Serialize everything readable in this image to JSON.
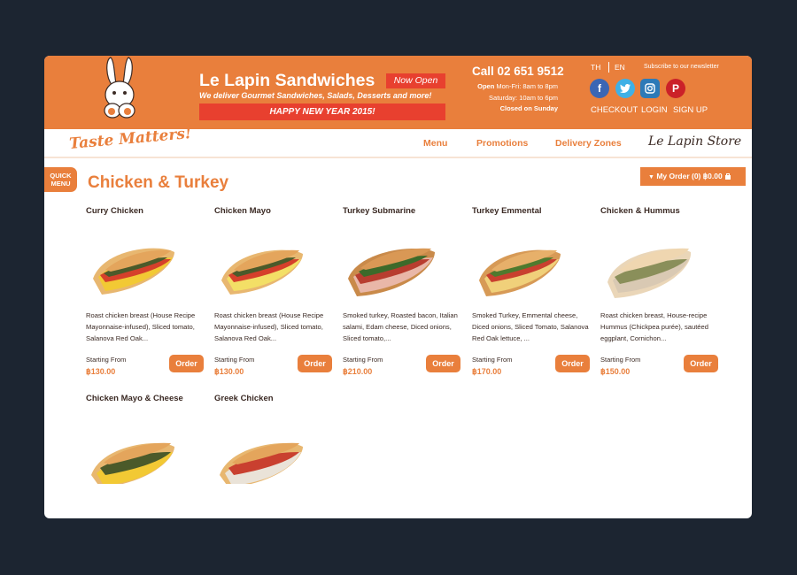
{
  "header": {
    "brand_title": "Le Lapin Sandwiches",
    "now_open": "Now Open",
    "tagline": "We deliver Gourmet Sandwiches, Salads, Desserts and more!",
    "promo_banner": "HAPPY NEW YEAR 2015!",
    "phone": "Call 02 651 9512",
    "hours_label": "Open",
    "hours_weekdays": "Mon-Fri: 8am to 8pm",
    "hours_saturday": "Saturday: 10am to 6pm",
    "hours_sunday": "Closed on Sunday",
    "lang_th": "TH",
    "lang_en": "EN",
    "newsletter": "Subscribe to our newsletter",
    "social_icons": [
      "facebook-icon",
      "twitter-icon",
      "instagram-icon",
      "pinterest-icon"
    ],
    "links": {
      "checkout": "CHECKOUT",
      "login": "LOGIN",
      "signup": "SIGN UP"
    }
  },
  "nav": {
    "slogan": "Taste Matters!",
    "items": [
      "Menu",
      "Promotions",
      "Delivery Zones"
    ],
    "store": "Le Lapin Store"
  },
  "content": {
    "quick_menu_line1": "QUICK",
    "quick_menu_line2": "MENU",
    "page_title": "Chicken & Turkey",
    "my_order": "My Order (0) ฿0.00"
  },
  "products": [
    {
      "name": "Curry Chicken",
      "desc": "Roast chicken breast (House Recipe Mayonnaise-infused), Sliced tomato, Salanova Red Oak...",
      "starting_label": "Starting From",
      "price": "฿130.00",
      "order_label": "Order"
    },
    {
      "name": "Chicken Mayo",
      "desc": "Roast chicken breast (House Recipe Mayonnaise-infused), Sliced tomato, Salanova Red Oak...",
      "starting_label": "Starting From",
      "price": "฿130.00",
      "order_label": "Order"
    },
    {
      "name": "Turkey Submarine",
      "desc": "Smoked turkey, Roasted bacon, Italian salami, Edam cheese, Diced onions, Sliced tomato,...",
      "starting_label": "Starting From",
      "price": "฿210.00",
      "order_label": "Order"
    },
    {
      "name": "Turkey Emmental",
      "desc": "Smoked Turkey, Emmental cheese, Diced onions, Sliced Tomato, Salanova Red Oak lettuce, ...",
      "starting_label": "Starting From",
      "price": "฿170.00",
      "order_label": "Order"
    },
    {
      "name": "Chicken & Hummus",
      "desc": "Roast chicken breast, House-recipe Hummus (Chickpea purée), sautéed eggplant, Cornichon...",
      "starting_label": "Starting From",
      "price": "฿150.00",
      "order_label": "Order"
    },
    {
      "name": "Chicken Mayo & Cheese"
    },
    {
      "name": "Greek Chicken"
    }
  ],
  "colors": {
    "brand_orange": "#e97f3c",
    "banner_red": "#e8402f",
    "backdrop": "#1c2531",
    "text_dark": "#3b2a24"
  }
}
